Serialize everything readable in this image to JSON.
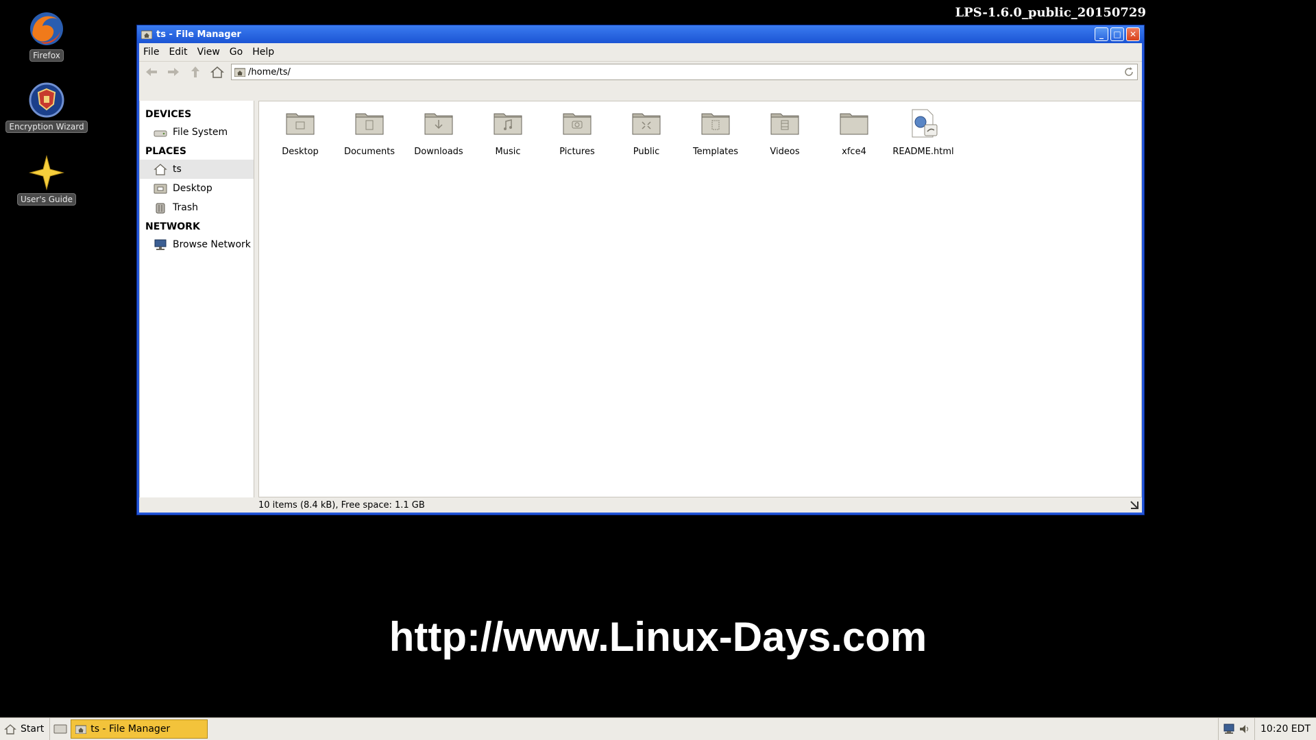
{
  "version_label": "LPS-1.6.0_public_20150729",
  "desktop": {
    "icons": [
      {
        "label": "Firefox"
      },
      {
        "label": "Encryption Wizard"
      },
      {
        "label": "User's Guide"
      }
    ]
  },
  "window": {
    "title": "ts - File Manager",
    "menu": [
      "File",
      "Edit",
      "View",
      "Go",
      "Help"
    ],
    "address": "/home/ts/",
    "sidebar": {
      "devices_header": "DEVICES",
      "devices": [
        "File System"
      ],
      "places_header": "PLACES",
      "places": [
        "ts",
        "Desktop",
        "Trash"
      ],
      "network_header": "NETWORK",
      "network": [
        "Browse Network"
      ]
    },
    "files": [
      "Desktop",
      "Documents",
      "Downloads",
      "Music",
      "Pictures",
      "Public",
      "Templates",
      "Videos",
      "xfce4",
      "README.html"
    ],
    "status": "10 items (8.4 kB), Free space: 1.1 GB"
  },
  "watermark": "http://www.Linux-Days.com",
  "taskbar": {
    "start_label": "Start",
    "task_label": "ts - File Manager",
    "clock": "10:20 EDT"
  },
  "colors": {
    "titlebar": "#2356d8",
    "task_active": "#f3c33b",
    "panel": "#edebe6"
  }
}
